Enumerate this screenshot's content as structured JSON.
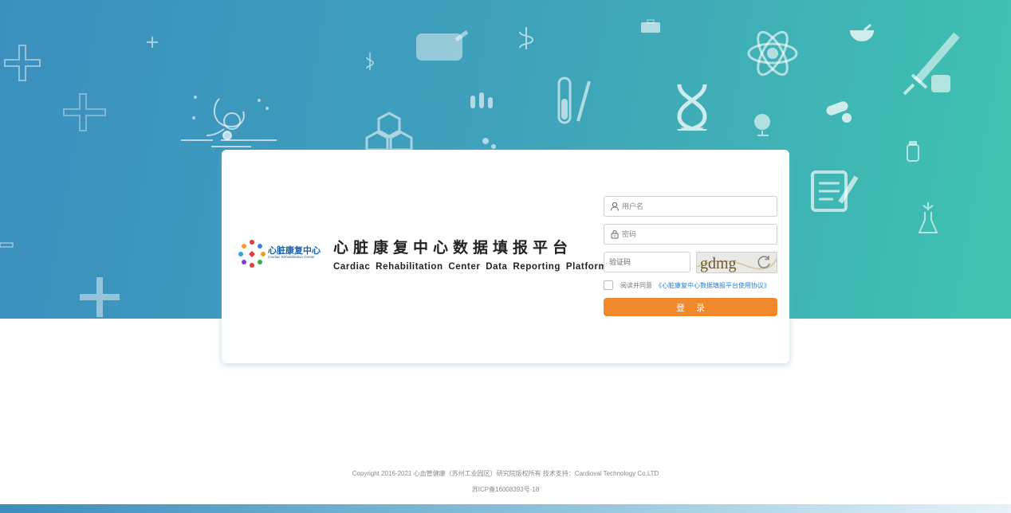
{
  "brand": {
    "logo_cn": "心脏康复中心",
    "logo_en": "Cardiac Rehabilitation Center"
  },
  "title": {
    "cn": "心脏康复中心数据填报平台",
    "en": "Cardiac Rehabilitation Center Data Reporting Platform"
  },
  "login_form": {
    "username_placeholder": "用户名",
    "password_placeholder": "密码",
    "captcha_placeholder": "验证码",
    "captcha_text": "gdmg",
    "agree_prefix": "阅读并同意",
    "agree_link": "《心脏康复中心数据填报平台使用协议》",
    "login_label": "登录"
  },
  "footer": {
    "copyright": "Copyright 2016-2021 心血管健康（苏州工业园区）研究院版权所有 技术支持：Cardioval Technology Co.LTD",
    "icp": "苏ICP备16008393号-18"
  },
  "colors": {
    "hero_start": "#3b8fbe",
    "hero_end": "#3fc3b0",
    "login_button": "#f0882c",
    "link": "#2a7fd4"
  },
  "decorative_icons": [
    "plus-icon",
    "stethoscope-icon",
    "pill-bottle-icon",
    "test-tubes-icon",
    "molecule-icon",
    "dna-icon",
    "globe-icon",
    "atom-icon",
    "bowl-icon",
    "syringe-icon",
    "clipboard-icon",
    "flask-icon",
    "first-aid-kit-icon",
    "capsule-icon",
    "caduceus-icon",
    "microscope-icon"
  ]
}
